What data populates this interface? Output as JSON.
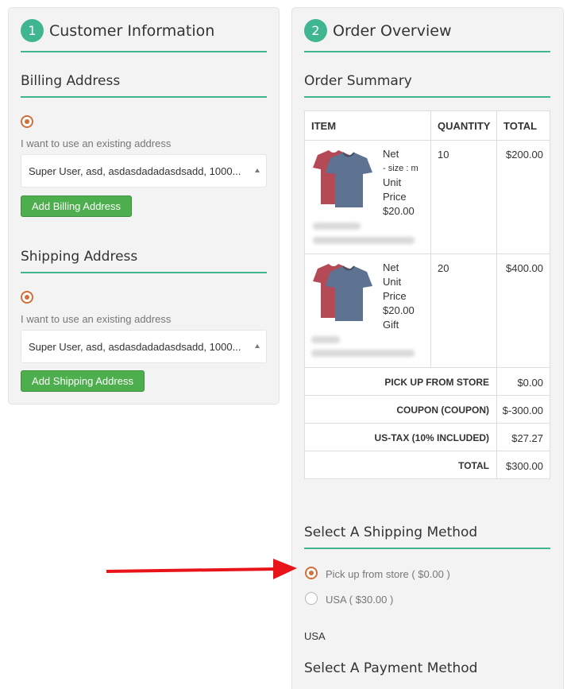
{
  "customer": {
    "step_number": "1",
    "title": "Customer Information",
    "billing": {
      "title": "Billing Address",
      "hint": "I want to use an existing address",
      "selected_address": "Super User, asd, asdasdadadasdsadd, 1000...",
      "add_button": "Add Billing Address"
    },
    "shipping": {
      "title": "Shipping Address",
      "hint": "I want to use an existing address",
      "selected_address": "Super User, asd, asdasdadadasdsadd, 1000...",
      "add_button": "Add Shipping Address"
    }
  },
  "order": {
    "step_number": "2",
    "title": "Order Overview",
    "summary_title": "Order Summary",
    "columns": [
      "ITEM",
      "QUANTITY",
      "TOTAL"
    ],
    "items": [
      {
        "line1": "Net",
        "line2": "- size : m",
        "line3": "Unit",
        "line4": "Price",
        "line5": "$20.00",
        "quantity": "10",
        "total": "$200.00"
      },
      {
        "line1": "Net",
        "line2": "Unit",
        "line3": "Price",
        "line4": "$20.00",
        "line5": "Gift",
        "quantity": "20",
        "total": "$400.00"
      }
    ],
    "totals": [
      {
        "label": "PICK UP FROM STORE",
        "value": "$0.00"
      },
      {
        "label": "COUPON (COUPON)",
        "value": "$-300.00"
      },
      {
        "label": "US-TAX (10% INCLUDED)",
        "value": "$27.27"
      },
      {
        "label": "TOTAL",
        "value": "$300.00"
      }
    ],
    "shipping_method": {
      "title": "Select A Shipping Method",
      "options": [
        {
          "label": "Pick up from store ( $0.00 )",
          "selected": true
        },
        {
          "label": "USA ( $30.00 )",
          "selected": false
        }
      ],
      "group_label": "USA"
    },
    "payment_method": {
      "title": "Select A Payment Method"
    }
  },
  "colors": {
    "accent": "#3fb68f",
    "button": "#4cae4c",
    "radio": "#cf6f3b",
    "arrow": "#e8141a"
  }
}
